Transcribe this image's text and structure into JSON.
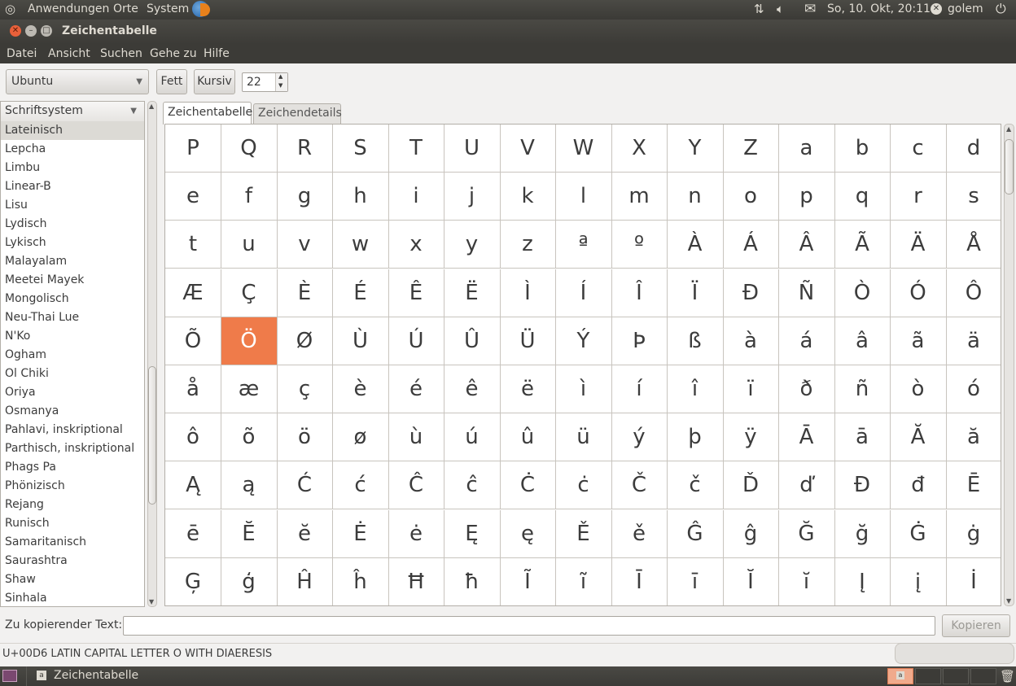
{
  "top_panel": {
    "menus": [
      "Anwendungen",
      "Orte",
      "System"
    ],
    "clock": "So, 10. Okt, 20:11",
    "user": "golem"
  },
  "window": {
    "title": "Zeichentabelle",
    "menu": [
      "Datei",
      "Ansicht",
      "Suchen",
      "Gehe zu",
      "Hilfe"
    ]
  },
  "toolbar": {
    "font": "Ubuntu",
    "bold_label": "Fett",
    "italic_label": "Kursiv",
    "size": "22"
  },
  "sidebar": {
    "header": "Schriftsystem",
    "items": [
      "Lateinisch",
      "Lepcha",
      "Limbu",
      "Linear-B",
      "Lisu",
      "Lydisch",
      "Lykisch",
      "Malayalam",
      "Meetei Mayek",
      "Mongolisch",
      "Neu-Thai Lue",
      "N'Ko",
      "Ogham",
      "Ol Chiki",
      "Oriya",
      "Osmanya",
      "Pahlavi, inskriptional",
      "Parthisch, inskriptional",
      "Phags Pa",
      "Phönizisch",
      "Rejang",
      "Runisch",
      "Samaritanisch",
      "Saurashtra",
      "Shaw",
      "Sinhala"
    ],
    "selected": "Lateinisch"
  },
  "tabs": [
    "Zeichentabelle",
    "Zeichendetails"
  ],
  "grid": {
    "rows": [
      [
        "P",
        "Q",
        "R",
        "S",
        "T",
        "U",
        "V",
        "W",
        "X",
        "Y",
        "Z",
        "a",
        "b",
        "c",
        "d"
      ],
      [
        "e",
        "f",
        "g",
        "h",
        "i",
        "j",
        "k",
        "l",
        "m",
        "n",
        "o",
        "p",
        "q",
        "r",
        "s"
      ],
      [
        "t",
        "u",
        "v",
        "w",
        "x",
        "y",
        "z",
        "ª",
        "º",
        "À",
        "Á",
        "Â",
        "Ã",
        "Ä",
        "Å"
      ],
      [
        "Æ",
        "Ç",
        "È",
        "É",
        "Ê",
        "Ë",
        "Ì",
        "Í",
        "Î",
        "Ï",
        "Ð",
        "Ñ",
        "Ò",
        "Ó",
        "Ô"
      ],
      [
        "Õ",
        "Ö",
        "Ø",
        "Ù",
        "Ú",
        "Û",
        "Ü",
        "Ý",
        "Þ",
        "ß",
        "à",
        "á",
        "â",
        "ã",
        "ä"
      ],
      [
        "å",
        "æ",
        "ç",
        "è",
        "é",
        "ê",
        "ë",
        "ì",
        "í",
        "î",
        "ï",
        "ð",
        "ñ",
        "ò",
        "ó"
      ],
      [
        "ô",
        "õ",
        "ö",
        "ø",
        "ù",
        "ú",
        "û",
        "ü",
        "ý",
        "þ",
        "ÿ",
        "Ā",
        "ā",
        "Ă",
        "ă"
      ],
      [
        "Ą",
        "ą",
        "Ć",
        "ć",
        "Ĉ",
        "ĉ",
        "Ċ",
        "ċ",
        "Č",
        "č",
        "Ď",
        "ď",
        "Đ",
        "đ",
        "Ē"
      ],
      [
        "ē",
        "Ĕ",
        "ĕ",
        "Ė",
        "ė",
        "Ę",
        "ę",
        "Ě",
        "ě",
        "Ĝ",
        "ĝ",
        "Ğ",
        "ğ",
        "Ġ",
        "ġ"
      ],
      [
        "Ģ",
        "ģ",
        "Ĥ",
        "ĥ",
        "Ħ",
        "ħ",
        "Ĩ",
        "ĩ",
        "Ī",
        "ī",
        "Ĭ",
        "ĭ",
        "Į",
        "į",
        "İ"
      ]
    ],
    "selected_char": "Ö"
  },
  "copy": {
    "label": "Zu kopierender Text:",
    "value": "",
    "button": "Kopieren"
  },
  "status": "U+00D6 LATIN CAPITAL LETTER O WITH DIAERESIS",
  "taskbar": {
    "task": "Zeichentabelle"
  },
  "colors": {
    "selection": "#ef7b4a",
    "panel": "#3c3b37",
    "close_button": "#e9603a"
  }
}
